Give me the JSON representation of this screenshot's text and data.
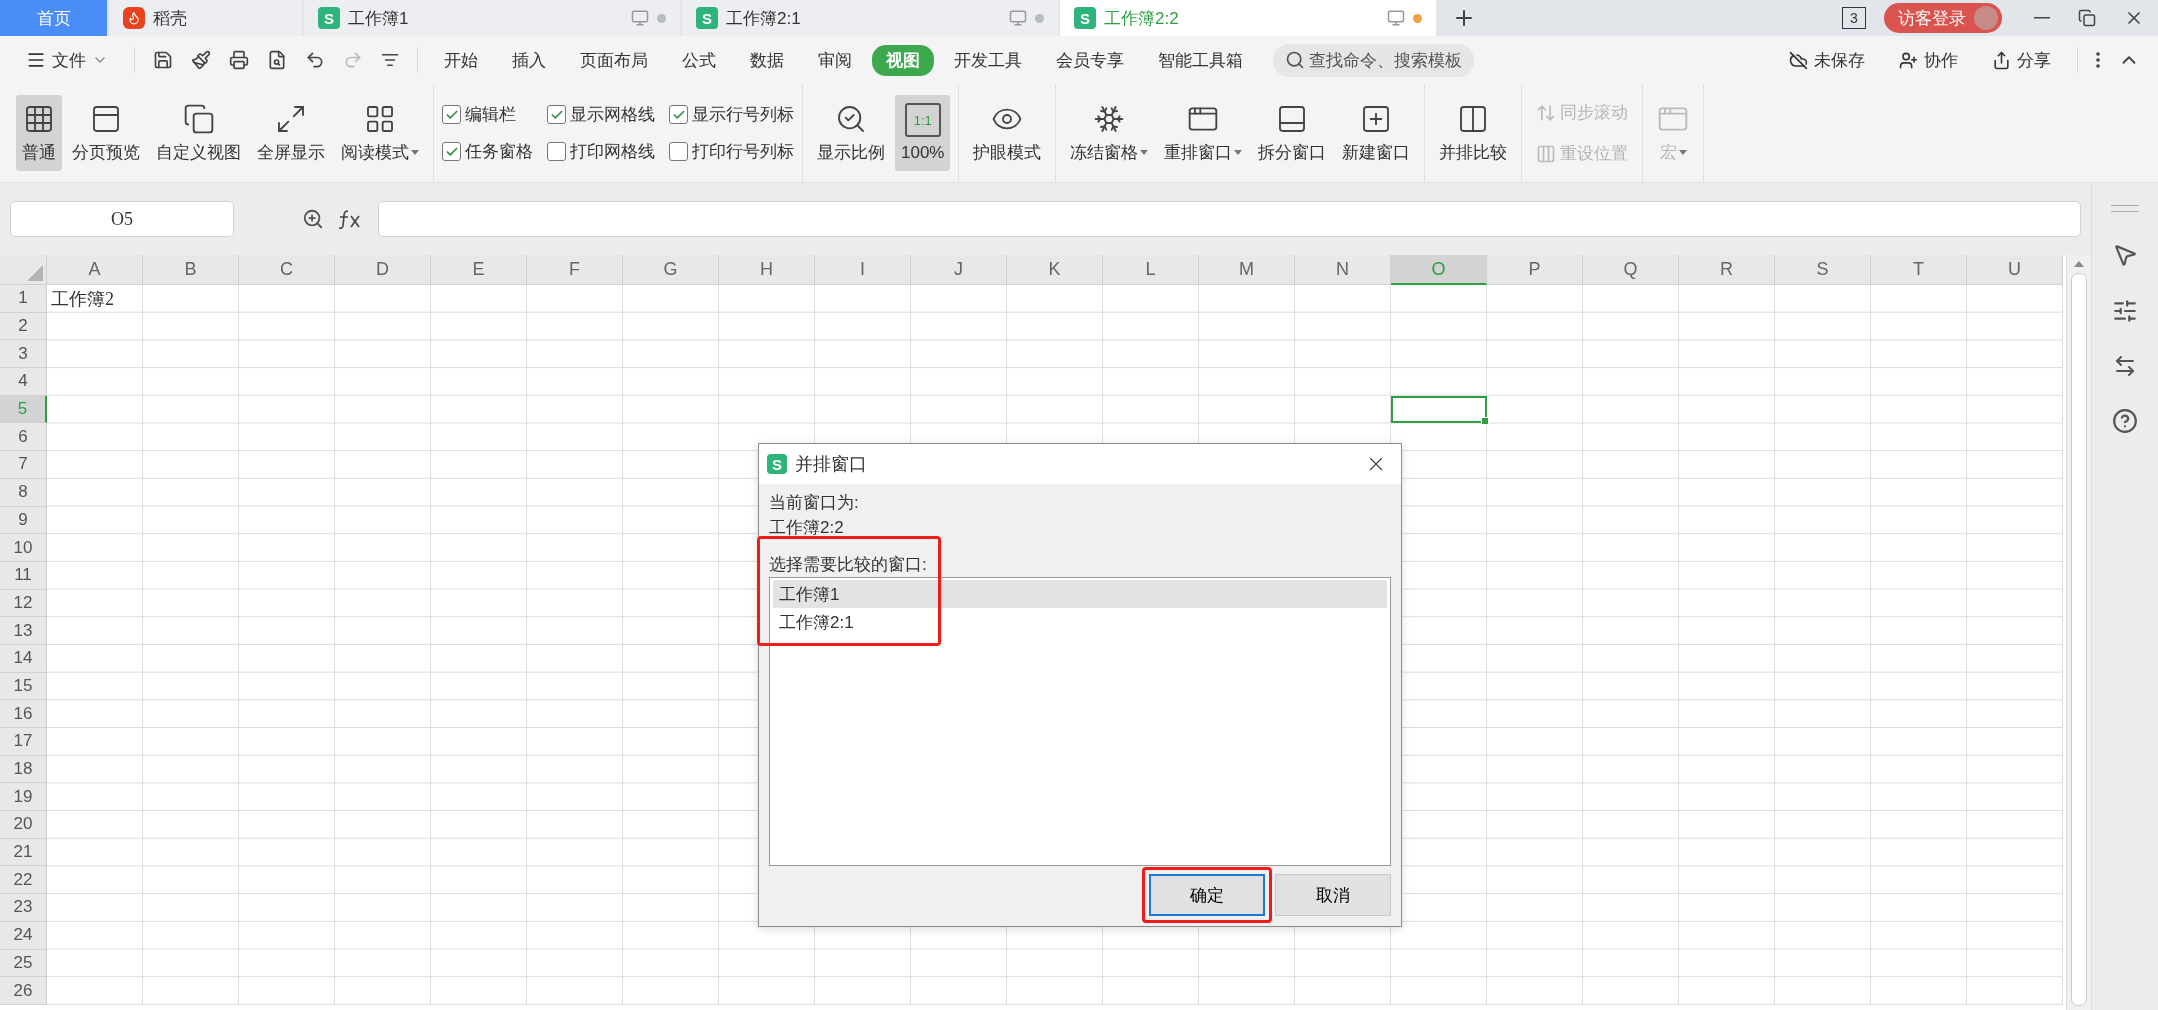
{
  "tabs": [
    {
      "kind": "home",
      "label": "首页",
      "selected": false
    },
    {
      "kind": "app",
      "label": "稻壳",
      "selected": false
    },
    {
      "kind": "sheet",
      "logo": "S",
      "label": "工作簿1",
      "selected": false,
      "modified": false
    },
    {
      "kind": "sheet",
      "logo": "S",
      "label": "工作簿2:1",
      "selected": false,
      "modified": false
    },
    {
      "kind": "sheet",
      "logo": "S",
      "label": "工作簿2:2",
      "selected": true,
      "modified": true
    }
  ],
  "window_count": "3",
  "login_button": "访客登录",
  "menu": {
    "file": "文件",
    "tabs": [
      {
        "label": "开始",
        "selected": false
      },
      {
        "label": "插入",
        "selected": false
      },
      {
        "label": "页面布局",
        "selected": false
      },
      {
        "label": "公式",
        "selected": false
      },
      {
        "label": "数据",
        "selected": false
      },
      {
        "label": "审阅",
        "selected": false
      },
      {
        "label": "视图",
        "selected": true
      },
      {
        "label": "开发工具",
        "selected": false
      },
      {
        "label": "会员专享",
        "selected": false
      },
      {
        "label": "智能工具箱",
        "selected": false
      }
    ],
    "search_placeholder": "查找命令、搜索模板",
    "actions": [
      "未保存",
      "协作",
      "分享"
    ]
  },
  "ribbon": [
    {
      "kind": "buttons",
      "items": [
        {
          "label": "普通",
          "selected": true,
          "dropdown": false,
          "disabled": false
        },
        {
          "label": "分页预览",
          "selected": false,
          "dropdown": false,
          "disabled": false
        },
        {
          "label": "自定义视图",
          "selected": false,
          "dropdown": false,
          "disabled": false
        },
        {
          "label": "全屏显示",
          "selected": false,
          "dropdown": false,
          "disabled": false
        },
        {
          "label": "阅读模式",
          "selected": false,
          "dropdown": true,
          "disabled": false
        }
      ]
    },
    {
      "kind": "checks",
      "items": [
        {
          "label": "编辑栏",
          "checked": true
        },
        {
          "label": "任务窗格",
          "checked": true
        },
        {
          "label": "显示网格线",
          "checked": true
        },
        {
          "label": "打印网格线",
          "checked": false
        },
        {
          "label": "显示行号列标",
          "checked": true
        },
        {
          "label": "打印行号列标",
          "checked": false
        }
      ]
    },
    {
      "kind": "buttons",
      "items": [
        {
          "label": "显示比例",
          "selected": false,
          "dropdown": false,
          "disabled": false
        },
        {
          "label": "100%",
          "icon_text": "1:1",
          "selected": true,
          "dropdown": false,
          "disabled": false
        }
      ]
    },
    {
      "kind": "buttons",
      "items": [
        {
          "label": "护眼模式",
          "selected": false,
          "dropdown": false,
          "disabled": false
        }
      ]
    },
    {
      "kind": "buttons",
      "items": [
        {
          "label": "冻结窗格",
          "selected": false,
          "dropdown": true,
          "disabled": false
        },
        {
          "label": "重排窗口",
          "selected": false,
          "dropdown": true,
          "disabled": false
        },
        {
          "label": "拆分窗口",
          "selected": false,
          "dropdown": false,
          "disabled": false
        },
        {
          "label": "新建窗口",
          "selected": false,
          "dropdown": false,
          "disabled": false
        }
      ]
    },
    {
      "kind": "buttons",
      "items": [
        {
          "label": "并排比较",
          "selected": false,
          "dropdown": false,
          "disabled": false
        }
      ]
    },
    {
      "kind": "small",
      "items": [
        {
          "label": "同步滚动",
          "disabled": true
        },
        {
          "label": "重设位置",
          "disabled": true
        }
      ]
    },
    {
      "kind": "buttons",
      "items": [
        {
          "label": "宏",
          "selected": false,
          "dropdown": true,
          "disabled": true
        }
      ]
    }
  ],
  "formula_bar": {
    "name_box": "O5"
  },
  "sheet": {
    "columns": [
      {
        "label": "A",
        "selected": false
      },
      {
        "label": "B",
        "selected": false
      },
      {
        "label": "C",
        "selected": false
      },
      {
        "label": "D",
        "selected": false
      },
      {
        "label": "E",
        "selected": false
      },
      {
        "label": "F",
        "selected": false
      },
      {
        "label": "G",
        "selected": false
      },
      {
        "label": "H",
        "selected": false
      },
      {
        "label": "I",
        "selected": false
      },
      {
        "label": "J",
        "selected": false
      },
      {
        "label": "K",
        "selected": false
      },
      {
        "label": "L",
        "selected": false
      },
      {
        "label": "M",
        "selected": false
      },
      {
        "label": "N",
        "selected": false
      },
      {
        "label": "O",
        "selected": true
      },
      {
        "label": "P",
        "selected": false
      },
      {
        "label": "Q",
        "selected": false
      },
      {
        "label": "R",
        "selected": false
      },
      {
        "label": "S",
        "selected": false
      },
      {
        "label": "T",
        "selected": false
      },
      {
        "label": "U",
        "selected": false
      }
    ],
    "rows": [
      {
        "label": "1",
        "selected": false,
        "cells": [
          "工作簿2"
        ]
      },
      {
        "label": "2",
        "selected": false
      },
      {
        "label": "3",
        "selected": false
      },
      {
        "label": "4",
        "selected": false
      },
      {
        "label": "5",
        "selected": true
      },
      {
        "label": "6",
        "selected": false
      },
      {
        "label": "7",
        "selected": false
      },
      {
        "label": "8",
        "selected": false
      },
      {
        "label": "9",
        "selected": false
      },
      {
        "label": "10",
        "selected": false
      },
      {
        "label": "11",
        "selected": false
      },
      {
        "label": "12",
        "selected": false
      },
      {
        "label": "13",
        "selected": false
      },
      {
        "label": "14",
        "selected": false
      },
      {
        "label": "15",
        "selected": false
      },
      {
        "label": "16",
        "selected": false
      },
      {
        "label": "17",
        "selected": false
      },
      {
        "label": "18",
        "selected": false
      },
      {
        "label": "19",
        "selected": false
      },
      {
        "label": "20",
        "selected": false
      },
      {
        "label": "21",
        "selected": false
      },
      {
        "label": "22",
        "selected": false
      },
      {
        "label": "23",
        "selected": false
      },
      {
        "label": "24",
        "selected": false
      },
      {
        "label": "25",
        "selected": false
      },
      {
        "label": "26",
        "selected": false
      }
    ]
  },
  "dialog": {
    "logo": "S",
    "title": "并排窗口",
    "current_label": "当前窗口为:",
    "current_value": "工作簿2:2",
    "prompt": "选择需要比较的窗口:",
    "highlighted": true,
    "windows": [
      {
        "label": "工作簿1",
        "selected": true
      },
      {
        "label": "工作簿2:1",
        "selected": false
      }
    ],
    "buttons": [
      {
        "kind": "primary",
        "label": "确定",
        "highlighted": true
      },
      {
        "kind": "default",
        "label": "取消",
        "highlighted": false
      }
    ]
  }
}
